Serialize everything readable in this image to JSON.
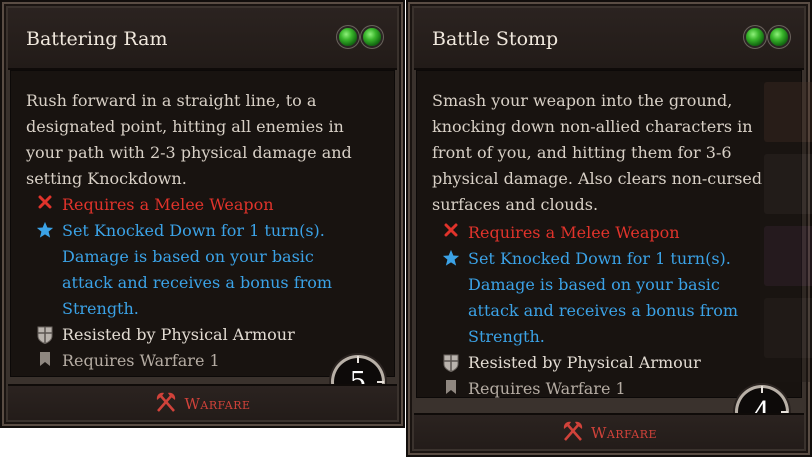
{
  "cards": [
    {
      "title": "Battering Ram",
      "orb_color": "#39b52b",
      "description": "Rush forward in a straight line, to a designated point, hitting all enemies in your path with 2-3 physical damage and setting Knockdown.",
      "requirement": "Requires a Melee Weapon",
      "effect_line1": "Set Knocked Down for 1 turn(s).",
      "effect_line2": "Damage is based on your basic attack and receives a bonus from Strength.",
      "resist": "Resisted by Physical Armour",
      "skill_req": "Requires Warfare 1",
      "cooldown": "5",
      "school": "Warfare"
    },
    {
      "title": "Battle Stomp",
      "orb_color": "#39b52b",
      "description": "Smash your weapon into the ground, knocking down non-allied characters in front of you, and hitting them for 3-6 physical damage. Also clears non-cursed surfaces and clouds.",
      "requirement": "Requires a Melee Weapon",
      "effect_line1": "Set Knocked Down for 1 turn(s).",
      "effect_line2": "Damage is based on your basic attack and receives a bonus from Strength.",
      "resist": "Resisted by Physical Armour",
      "skill_req": "Requires Warfare 1",
      "cooldown": "4",
      "school": "Warfare"
    }
  ],
  "colors": {
    "requirement": "#e0332b",
    "effect": "#3ba2e6",
    "school": "#d1423a"
  },
  "icons": {
    "requirement": "red-x-icon",
    "effect": "blue-star-icon",
    "resist": "armour-shield-icon",
    "skill_req": "bookmark-icon",
    "school": "warfare-crossed-axes-icon",
    "cooldown": "cooldown-clock-icon"
  }
}
